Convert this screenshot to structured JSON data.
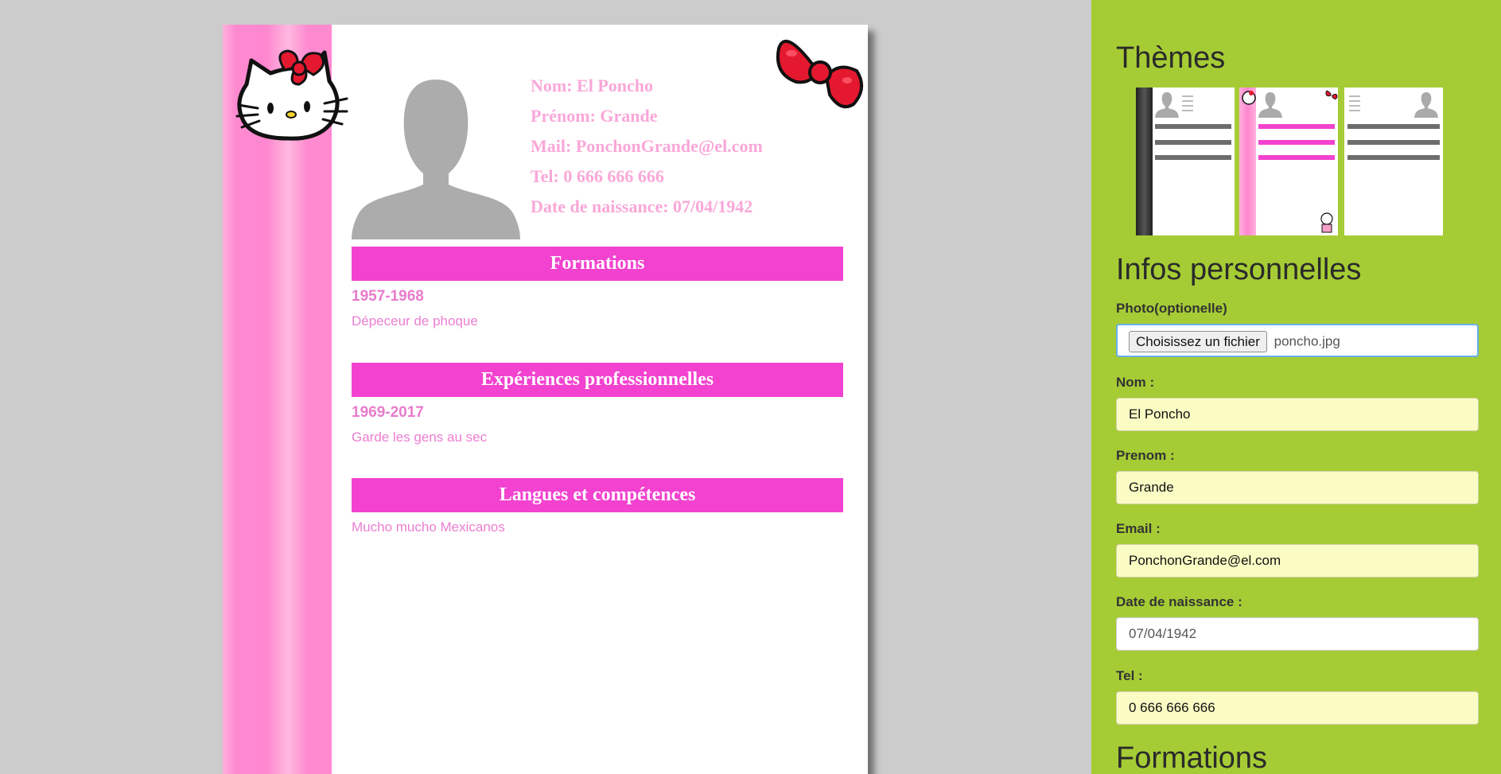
{
  "cv": {
    "nom": "Nom: El Poncho",
    "prenom": "Prénom: Grande",
    "mail": "Mail: PonchonGrande@el.com",
    "tel": "Tel: 0 666 666 666",
    "naissance": "Date de naissance: 07/04/1942",
    "sections": [
      {
        "title": "Formations",
        "year": "1957-1968",
        "desc": "Dépeceur de phoque"
      },
      {
        "title": "Expériences professionnelles",
        "year": "1969-2017",
        "desc": "Garde les gens au sec"
      },
      {
        "title": "Langues et compétences",
        "year": "",
        "desc": "Mucho mucho Mexicanos"
      }
    ]
  },
  "sidebar": {
    "themes_title": "Thèmes",
    "infos_title": "Infos personnelles",
    "photo_label": "Photo(optionelle)",
    "file_button": "Choisissez un fichier",
    "file_name": "poncho.jpg",
    "nom_label": "Nom :",
    "nom_value": "El Poncho",
    "prenom_label": "Prenom :",
    "prenom_value": "Grande",
    "email_label": "Email :",
    "email_value": "PonchonGrande@el.com",
    "date_label": "Date de naissance :",
    "date_value": "07/04/1942",
    "tel_label": "Tel :",
    "tel_value": "0 666 666 666",
    "formations_title": "Formations"
  },
  "colors": {
    "section_bar": "#f242cf",
    "sidebar_bg": "#a6cc35",
    "identity_text": "#f9a7d8"
  }
}
